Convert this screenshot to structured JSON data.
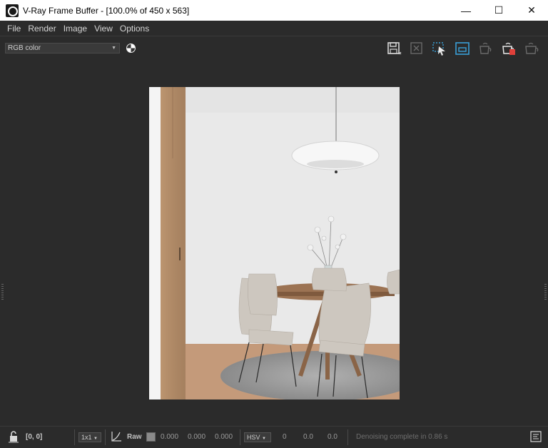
{
  "window": {
    "title": "V-Ray Frame Buffer - [100.0% of 450 x 563]",
    "controls": {
      "minimize": "—",
      "maximize": "☐",
      "close": "✕"
    }
  },
  "menu": {
    "items": [
      "File",
      "Render",
      "Image",
      "View",
      "Options"
    ]
  },
  "toolbar": {
    "channel": "RGB color",
    "icons": [
      "save-icon",
      "clear-image-icon",
      "region-render-icon",
      "track-mouse-icon",
      "render-last-icon",
      "stop-render-icon",
      "render-icon"
    ],
    "stop_color": "#e0403a",
    "accent_color": "#3aa0d8"
  },
  "status": {
    "coords": "[0, 0]",
    "sample_size": "1x1",
    "raw_label": "Raw",
    "r": "0.000",
    "g": "0.000",
    "b": "0.000",
    "color_mode": "HSV",
    "h": "0",
    "s": "0.0",
    "v": "0.0",
    "message": "Denoising complete in 0.86 s"
  }
}
